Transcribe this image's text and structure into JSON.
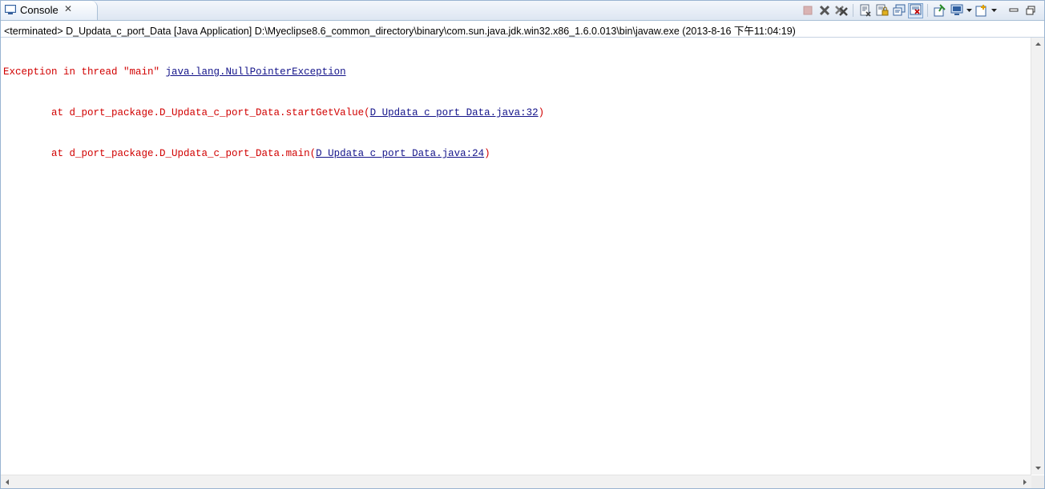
{
  "tab": {
    "label": "Console",
    "close_glyph": "✕"
  },
  "toolbar": {
    "buttons": [
      {
        "name": "terminate-icon",
        "enabled": false
      },
      {
        "name": "remove-launch-icon"
      },
      {
        "name": "remove-all-terminated-icon"
      },
      {
        "name": "clear-console-icon"
      },
      {
        "name": "scroll-lock-icon"
      },
      {
        "name": "show-console-on-output-icon"
      },
      {
        "name": "show-console-on-error-icon",
        "pressed": true
      },
      {
        "name": "pin-console-icon"
      },
      {
        "name": "display-selected-console-icon"
      },
      {
        "name": "open-console-icon"
      },
      {
        "name": "minimize-icon"
      },
      {
        "name": "maximize-icon"
      }
    ]
  },
  "process": {
    "description": "<terminated> D_Updata_c_port_Data [Java Application] D:\\Myeclipse8.6_common_directory\\binary\\com.sun.java.jdk.win32.x86_1.6.0.013\\bin\\javaw.exe (2013-8-16 下午11:04:19)"
  },
  "console": {
    "line1_prefix": "Exception in thread \"main\" ",
    "line1_link": "java.lang.NullPointerException",
    "line2_prefix": "\tat d_port_package.D_Updata_c_port_Data.startGetValue(",
    "line2_link": "D_Updata_c_port_Data.java:32",
    "line2_suffix": ")",
    "line3_prefix": "\tat d_port_package.D_Updata_c_port_Data.main(",
    "line3_link": "D_Updata_c_port_Data.java:24",
    "line3_suffix": ")"
  },
  "colors": {
    "error_text": "#d10000",
    "link_text": "#14148a",
    "frame_border": "#99b4d1"
  }
}
